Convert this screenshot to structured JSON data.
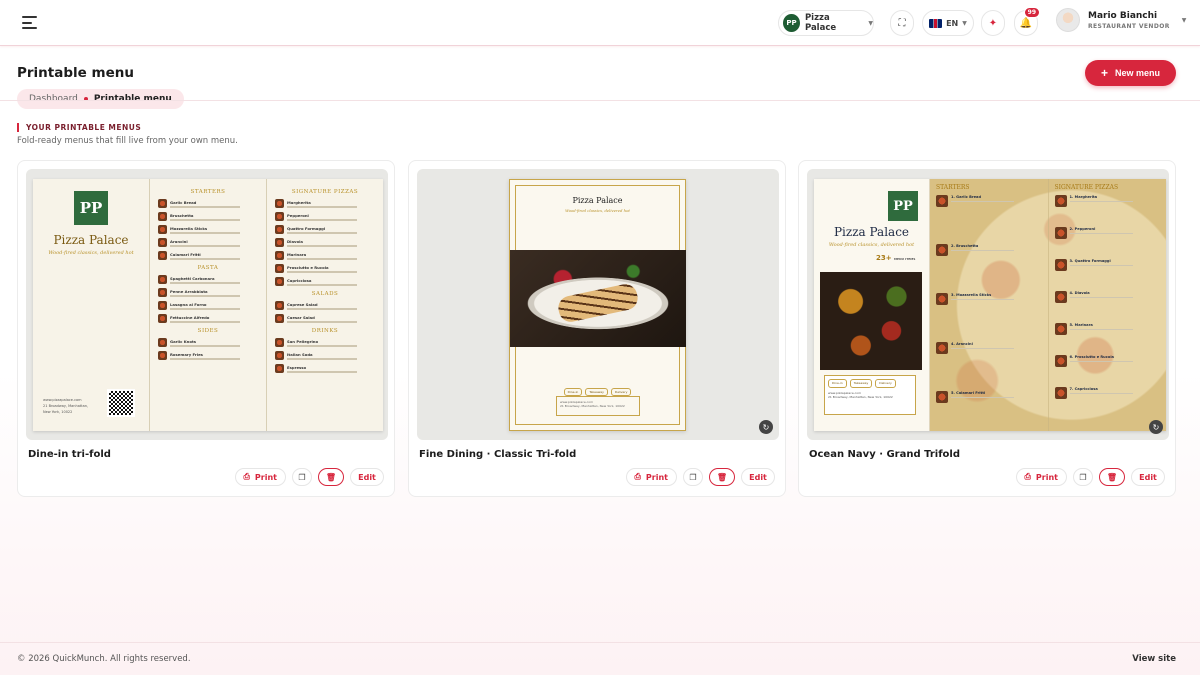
{
  "header": {
    "restaurant_logo": "PP",
    "restaurant_name": "Pizza Palace",
    "language": "EN",
    "notification_count": "99",
    "user_name": "Mario Bianchi",
    "user_role": "RESTAURANT VENDOR"
  },
  "page": {
    "title": "Printable menu",
    "breadcrumb_root": "Dashboard",
    "breadcrumb_current": "Printable menu",
    "new_menu_label": "New menu"
  },
  "section": {
    "kicker": "YOUR PRINTABLE MENUS",
    "subtitle": "Fold-ready menus that fill live from your own menu."
  },
  "cards": [
    {
      "title": "Dine-in tri-fold",
      "print_label": "Print",
      "edit_label": "Edit"
    },
    {
      "title": "Fine Dining · Classic Tri-fold",
      "print_label": "Print",
      "edit_label": "Edit"
    },
    {
      "title": "Ocean Navy · Grand Trifold",
      "print_label": "Print",
      "edit_label": "Edit"
    }
  ],
  "preview": {
    "brand": "Pizza Palace",
    "tagline": "Wood-fired classics, delivered hot",
    "logo": "PP",
    "tri1_sections": [
      "STARTERS",
      "PASTA",
      "SIDES",
      "SIGNATURE PIZZAS",
      "SALADS",
      "DRINKS"
    ],
    "tri1_starters": [
      "Garlic Bread",
      "Bruschetta",
      "Mozzarella Sticks",
      "Arancini",
      "Calamari Fritti"
    ],
    "tri1_pasta": [
      "Spaghetti Carbonara",
      "Penne Arrabbiata",
      "Lasagna al Forno",
      "Fettuccine Alfredo"
    ],
    "tri1_sides": [
      "Garlic Knots",
      "Rosemary Fries"
    ],
    "tri1_pizzas": [
      "Margherita",
      "Pepperoni",
      "Quattro Formaggi",
      "Diavola",
      "Marinara",
      "Prosciutto e Rucola",
      "Capricciosa"
    ],
    "tri1_salads": [
      "Caprese Salad",
      "Caesar Salad"
    ],
    "tri1_drinks": [
      "San Pellegrino",
      "Italian Soda",
      "Espresso"
    ],
    "fine_chips": [
      "Dine-in",
      "Takeaway",
      "Delivery"
    ],
    "ocean_count": "23+",
    "ocean_count_label": "MENU ITEMS",
    "ocean_chips": [
      "Dine-in",
      "Takeaway",
      "Delivery"
    ],
    "ocean_starters": [
      "1. Garlic Bread",
      "2. Bruschetta",
      "3. Mozzarella Sticks",
      "4. Arancini",
      "5. Calamari Fritti"
    ],
    "ocean_pizzas": [
      "1. Margherita",
      "2. Pepperoni",
      "3. Quattro Formaggi",
      "4. Diavola",
      "5. Marinara",
      "6. Prosciutto e Rucola",
      "7. Capricciosa"
    ],
    "website": "www.pizzapalace.com",
    "address": "21 Broadway, Manhattan, New York, 10022"
  },
  "footer": {
    "copyright": "© 2026 QuickMunch. All rights reserved.",
    "view_site": "View site"
  },
  "colors": {
    "accent": "#d7263d",
    "brand_green": "#2f6b3d",
    "gold": "#b8912a"
  }
}
